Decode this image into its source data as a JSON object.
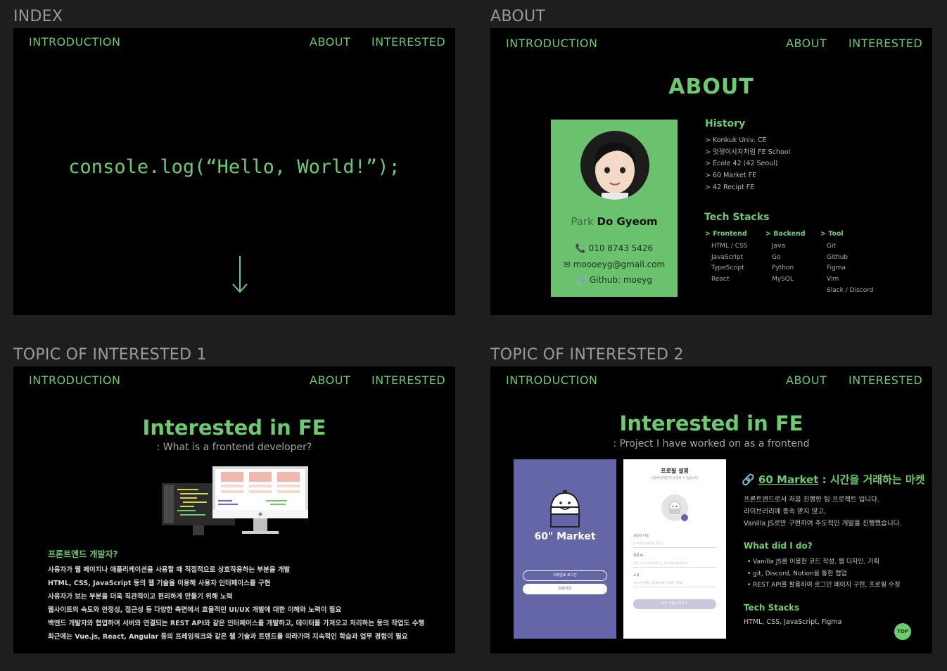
{
  "labels": {
    "index": "INDEX",
    "about": "ABOUT",
    "topic1": "TOPIC OF INTERESTED 1",
    "topic2": "TOPIC OF INTERESTED 2"
  },
  "nav": {
    "intro": "INTRODUCTION",
    "about": "ABOUT",
    "interested": "INTERESTED"
  },
  "index": {
    "code": "console.log(“Hello, World!”);"
  },
  "about": {
    "title": "ABOUT",
    "name_first": "Park ",
    "name_last": "Do Gyeom",
    "phone": "010 8743 5426",
    "email": "moooeyg@gmail.com",
    "github": "Github: moeyg",
    "history_title": "History",
    "history": [
      "> Konkuk Univ. CE",
      "> 멋쟁이사자처럼 FE School",
      "> École 42 (42 Seoul)",
      "> 60 Market FE",
      "> 42 Recipt FE"
    ],
    "stacks_title": "Tech Stacks",
    "frontend_head": "> Frontend",
    "frontend": [
      "HTML / CSS",
      "JavaScript",
      "TypeScript",
      "React"
    ],
    "backend_head": "> Backend",
    "backend": [
      "Java",
      "Go",
      "Python",
      "MySQL"
    ],
    "tool_head": "> Tool",
    "tool": [
      "Git",
      "Github",
      "Figma",
      "Vim",
      "Slack / Discord"
    ]
  },
  "topic1": {
    "title": "Interested in FE",
    "subtitle": ": What is a frontend developer?",
    "heading": "프론트엔드 개발자?",
    "lines": [
      "사용자가 웹 페이지나 애플리케이션을 사용할 때 직접적으로 상호작용하는 부분을 개발",
      "HTML, CSS, JavaScript 등의 웹 기술을 이용해 사용자 인터페이스를 구현",
      "사용자가 보는 부분을 더욱 직관적이고 편리하게 만들기 위해 노력",
      "웹사이트의 속도와 안정성, 접근성 등 다양한 측면에서 효율적인 UI/UX 개발에 대한 이해와 노력이 필요",
      "백엔드 개발자와 협업하여 서버와 연결되는 REST API와 같은 인터페이스를 개발하고, 데이터를 가져오고 처리하는 등의 작업도 수행",
      "최근에는 Vue.js, React, Angular 등의 프레임워크와 같은 웹 기술과 트렌드를 따라가며 지속적인 학습과 업무 경험이 필요"
    ]
  },
  "topic2": {
    "title": "Interested in FE",
    "subtitle": ": Project I have worked on as a frontend",
    "app_name": "60\" Market",
    "btn_login": "이메일로 로그인",
    "btn_signup": "회원가입",
    "profile_title": "프로필 설정",
    "profile_sub": "나중에 언제든지 변경할 수 있습니다.",
    "field_name": "사용자 이름",
    "field_name_ph": "2~10자 이내여야 합니다.",
    "field_id": "계정 ID",
    "field_id_ph": "영문, 숫자, 특수문자(.),(_)만 사용 가능합니다.",
    "field_intro": "소개",
    "field_intro_ph": "자신과 판매할 상품에 대해 소개해 주세요!",
    "start_btn": "60\" 마켓 시작하기",
    "project_link": "60 Market",
    "project_desc": " : 시간을 거래하는 마켓",
    "desc": [
      "프론트엔드로서 처음 진행한 팀 프로젝트 입니다.",
      "라이브러리에 종속 받지 않고,",
      "Vanilla JS로만 구현하여 주도적인 개발을 진행했습니다."
    ],
    "did_title": "What did I do?",
    "did": [
      "•  Vanilla JS를 이용한 코드 작성, 웹 디자인, 기획",
      "•  git, Discord, Notion을 통한 협업",
      "•  REST API를 활용하여 로그인 페이지 구현, 프로필 수정"
    ],
    "stack_title": "Tech Stacks",
    "stack": "HTML, CSS, JavaScript, Figma",
    "top": "TOP"
  }
}
